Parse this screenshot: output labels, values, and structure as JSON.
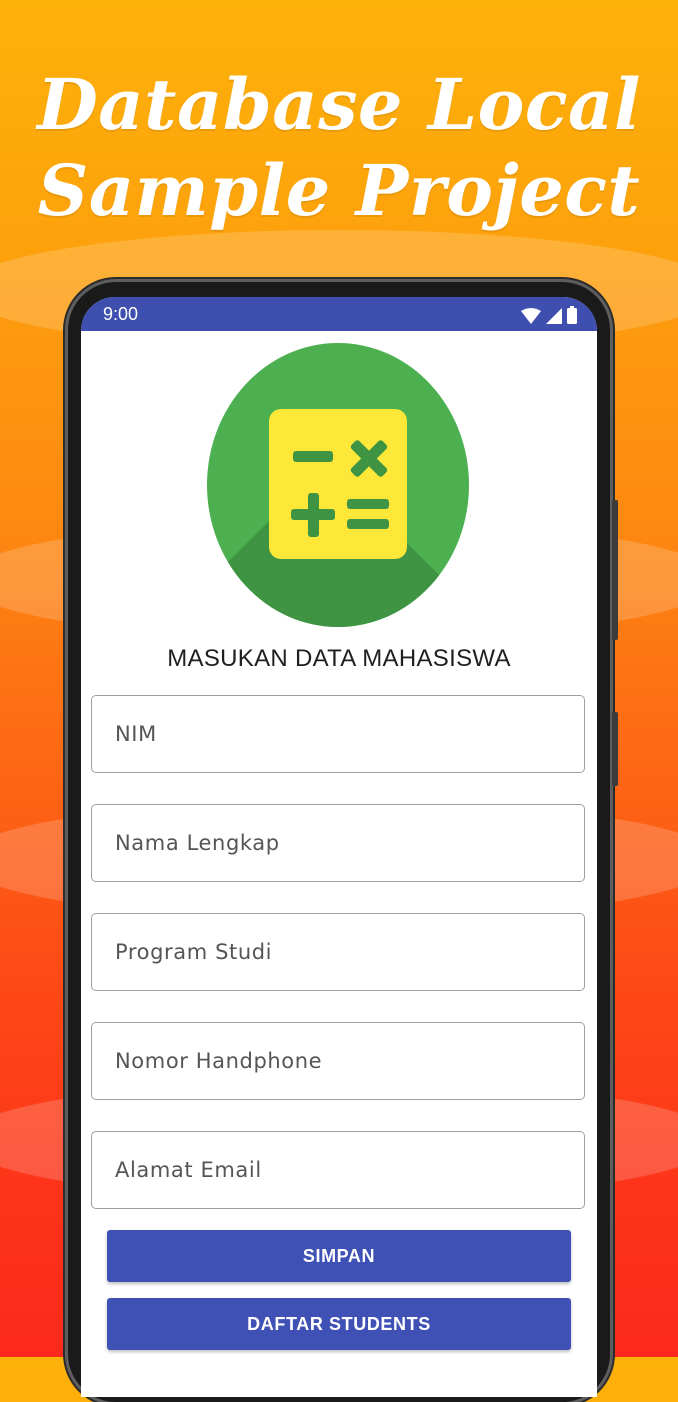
{
  "promo": {
    "headline_line1": "Database Local",
    "headline_line2": "Sample Project"
  },
  "status_bar": {
    "time": "9:00",
    "icons": [
      "wifi-icon",
      "signal-icon",
      "battery-icon"
    ]
  },
  "app": {
    "logo_icon": "calculator-icon",
    "title": "MASUKAN DATA MAHASISWA",
    "fields": {
      "nim": "NIM",
      "nama": "Nama Lengkap",
      "prodi": "Program Studi",
      "hp": "Nomor Handphone",
      "email": "Alamat Email"
    },
    "buttons": {
      "simpan": "SIMPAN",
      "daftar": "DAFTAR STUDENTS"
    }
  },
  "colors": {
    "primary": "#3f51b5",
    "status_bar": "#3f4fb0",
    "logo_green": "#4cb050",
    "logo_yellow": "#fde83a",
    "background_top": "#fdb20a",
    "background_bottom": "#fc2a1c"
  }
}
